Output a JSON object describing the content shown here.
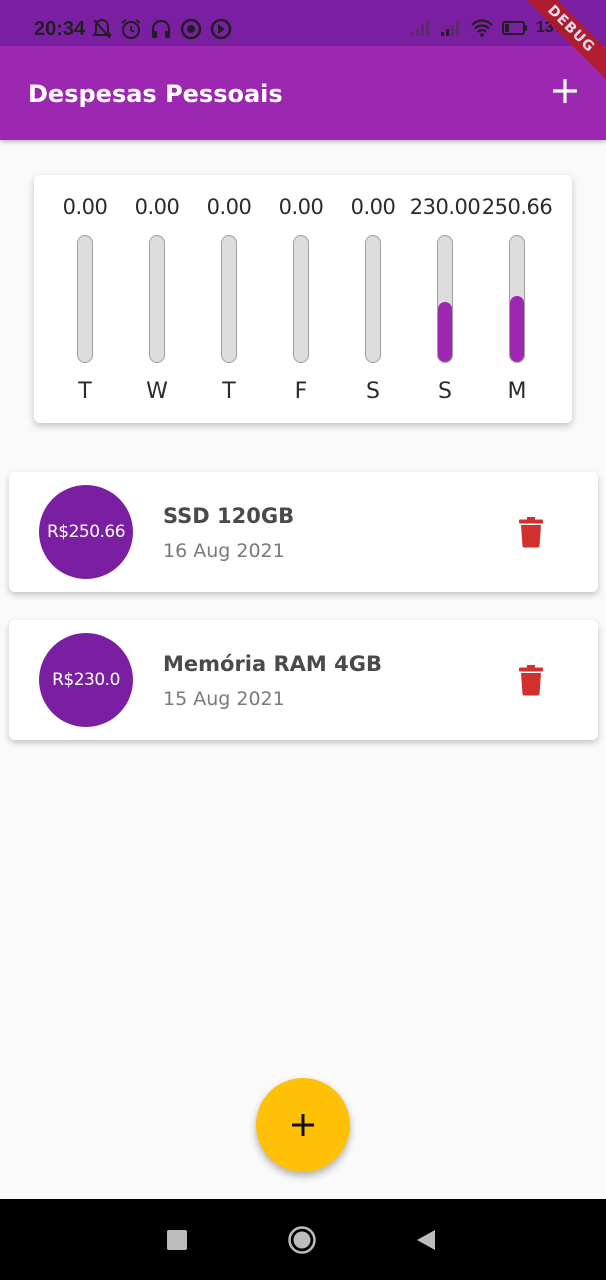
{
  "status_bar": {
    "time": "20:34",
    "battery": "13%"
  },
  "debug_banner": "DEBUG",
  "app_bar": {
    "title": "Despesas Pessoais"
  },
  "chart_data": {
    "type": "bar",
    "categories": [
      "T",
      "W",
      "T",
      "F",
      "S",
      "S",
      "M"
    ],
    "values": [
      0.0,
      0.0,
      0.0,
      0.0,
      0.0,
      230.0,
      250.66
    ],
    "labels": [
      "0.00",
      "0.00",
      "0.00",
      "0.00",
      "0.00",
      "230.00",
      "250.66"
    ],
    "fill_fraction": [
      0,
      0,
      0,
      0,
      0,
      0.478,
      0.521
    ],
    "bar_color": "#9c27b0"
  },
  "transactions": [
    {
      "amount": "R$250.66",
      "title": "SSD 120GB",
      "date": "16 Aug 2021"
    },
    {
      "amount": "R$230.0",
      "title": "Memória RAM 4GB",
      "date": "15 Aug 2021"
    }
  ],
  "colors": {
    "primary": "#9c27b0",
    "primary_dark": "#7b1fa2",
    "accent": "#ffc107",
    "delete": "#d32f2f"
  }
}
